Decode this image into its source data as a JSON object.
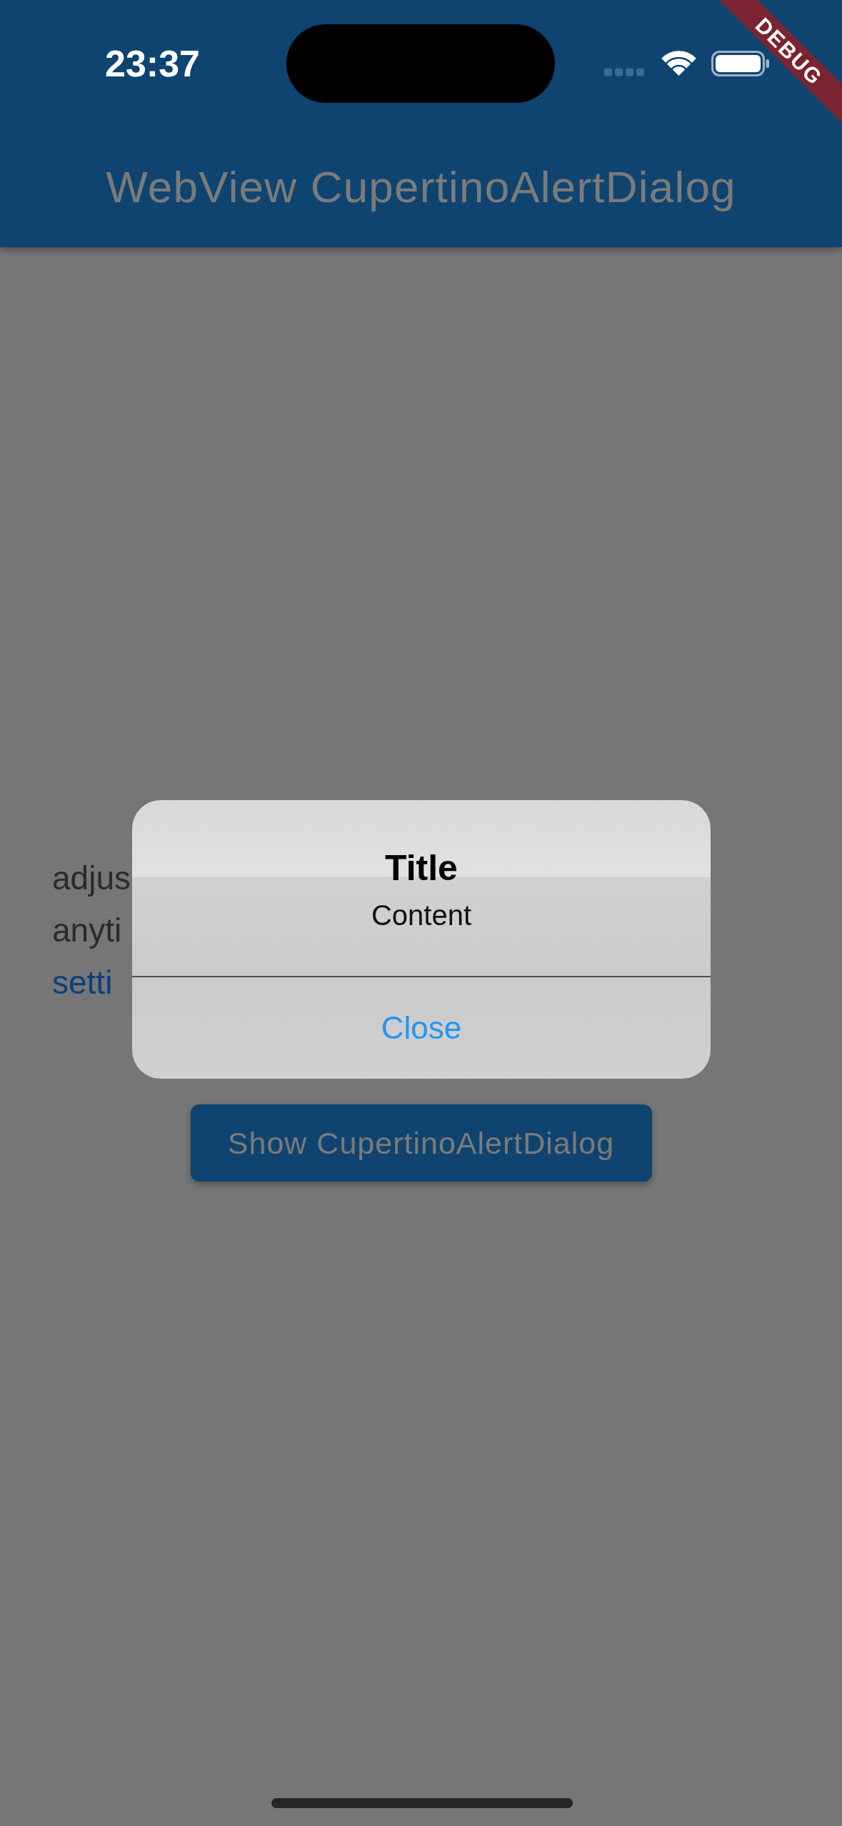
{
  "status_bar": {
    "time": "23:37"
  },
  "debug_banner": {
    "label": "DEBUG"
  },
  "app_bar": {
    "title": "WebView CupertinoAlertDialog"
  },
  "page": {
    "text_lines": [
      {
        "text": "adjus",
        "kind": "text"
      },
      {
        "text": "anyti",
        "kind": "text"
      },
      {
        "text": "setti",
        "kind": "link"
      }
    ],
    "button": {
      "label": "Show CupertinoAlertDialog"
    }
  },
  "dialog": {
    "title": "Title",
    "content": "Content",
    "actions": [
      {
        "label": "Close"
      }
    ]
  }
}
